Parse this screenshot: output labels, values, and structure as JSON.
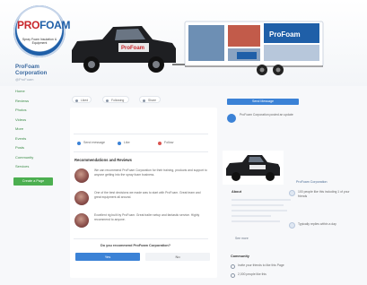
{
  "brand": {
    "logo_word_pro": "PRO",
    "logo_word_foam": "FOAM",
    "logo_subtitle": "Spray Foam Insulation & Equipment"
  },
  "colors": {
    "accent_blue": "#3b82d6",
    "nav_green": "#3a8b45",
    "cta_green": "#4caf50",
    "brand_red": "#c8262b",
    "truck_black": "#1e1f22"
  },
  "profile": {
    "name_line1": "ProFoam",
    "name_line2": "Corporation",
    "handle": "@ProFoam"
  },
  "nav": {
    "items": [
      "Home",
      "Reviews",
      "Photos",
      "Videos",
      "More",
      "Events",
      "Posts",
      "Community",
      "Services"
    ],
    "cta": "Create a Page"
  },
  "main": {
    "tabs": [
      "Liked",
      "Following",
      "Share"
    ],
    "actions": [
      "Send message",
      "Like",
      "Follow"
    ],
    "section_title": "Recommendations and Reviews",
    "reviews": [
      "We can recommend ProFoam Corporation for their training, products and support to anyone getting into the spray foam business.",
      "One of the best decisions we made was to start with ProFoam. Great team and great equipment all around.",
      "Excellent rig built by ProFoam. Great trailer setup and fantastic service. Highly recommend to anyone."
    ],
    "question": "Do you recommend ProFoam Corporation?",
    "yes_label": "Yes",
    "no_label": "No"
  },
  "right": {
    "send_label": "Send Message",
    "post_text": "ProFoam Corporation posted an update",
    "about_title": "About",
    "about_link": "See more",
    "page_name": "ProFoam Corporation",
    "side_items": [
      "100 people like this including 1 of your friends",
      "Typically replies within a day"
    ],
    "community_title": "Community",
    "community": [
      {
        "label": "Invite your friends to like this Page",
        "value": ""
      },
      {
        "label": "2,000 people like this",
        "value": ""
      }
    ]
  }
}
